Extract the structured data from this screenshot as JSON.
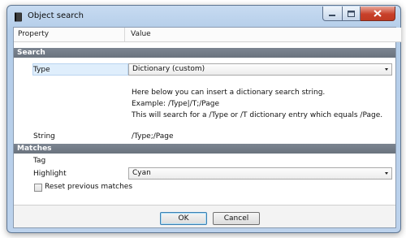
{
  "window": {
    "title": "Object search"
  },
  "grid": {
    "header_property": "Property",
    "header_value": "Value",
    "categories": [
      "Search",
      "Matches"
    ],
    "search": {
      "type_label": "Type",
      "type_value": "Dictionary (custom)",
      "help_lines": [
        "Here below you can insert a dictionary search string.",
        "Example: /Type|/T;/Page",
        "This will search for a /Type or /T dictionary entry which equals /Page."
      ],
      "string_label": "String",
      "string_value": "/Type;/Page"
    },
    "matches": {
      "tag_label": "Tag",
      "highlight_label": "Highlight",
      "highlight_value": "Cyan",
      "reset_label": "Reset previous matches",
      "reset_checked": false
    }
  },
  "buttons": {
    "ok": "OK",
    "cancel": "Cancel"
  },
  "colors": {
    "category_band": "#747d88",
    "selected_row": "#dfeefc",
    "close_button": "#c8402a",
    "default_button_border": "#3c7fb1"
  },
  "icons": [
    "book-icon",
    "minimize-icon",
    "maximize-icon",
    "close-icon",
    "chevron-down-icon"
  ]
}
